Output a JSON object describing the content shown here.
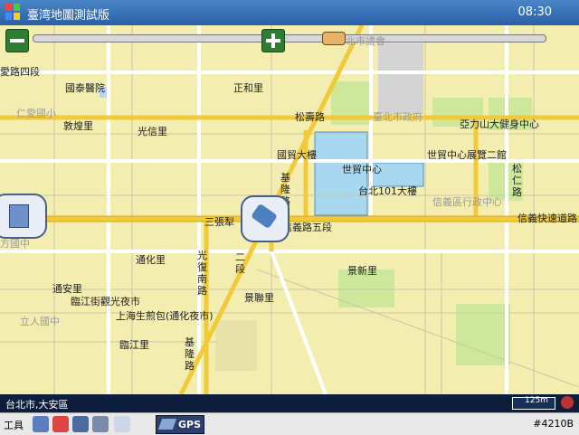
{
  "titlebar": {
    "title": "臺湾地圖測試版",
    "time": "08:30"
  },
  "map_labels": {
    "l1": "愛路四段",
    "l2": "仁愛國小",
    "l3": "國泰醫院",
    "l4": "正和里",
    "l5": "敦煌里",
    "l6": "光信里",
    "l7": "松壽路",
    "l8": "臺北市政府",
    "l9": "亞力山大健身中心",
    "l10": "世貿中心展覽二館",
    "l11": "松仁路",
    "l12": "國貿大樓",
    "l13": "世貿中心",
    "l14": "台北101大樓",
    "l15": "信義區行政中心",
    "l16": "信義快速道路",
    "l17": "基隆路",
    "l18": "三張犁",
    "l19": "信義路五段",
    "l20": "通化里",
    "l21": "光復南路",
    "l22": "二段",
    "l23": "景新里",
    "l24": "通安里",
    "l25": "臨江街觀光夜市",
    "l26": "上海生煎包(通化夜市)",
    "l27": "景聯里",
    "l28": "臨江里",
    "l29": "基隆路",
    "l30": "方國中",
    "l31": "立人國中",
    "l32": "北市議會"
  },
  "status": {
    "location": "台北市,大安區",
    "scale": "125m"
  },
  "toolbar": {
    "tools": "工具",
    "gps": "GPS",
    "map_id": "#4210B"
  },
  "icons": [
    "windows-logo-icon",
    "zoom-out-icon",
    "zoom-in-icon",
    "poi-list-icon",
    "vehicle-icon",
    "compass-icon",
    "search-icon",
    "favorite-icon",
    "car-icon",
    "route-icon",
    "cursor-icon",
    "satellite-icon"
  ]
}
